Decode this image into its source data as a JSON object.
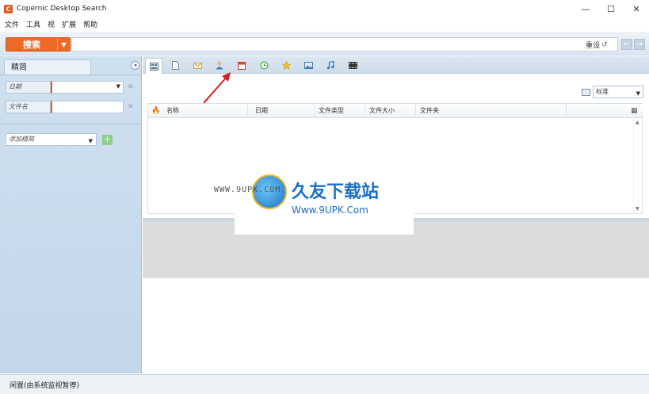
{
  "window": {
    "title": "Copernic Desktop Search",
    "minimize": "—",
    "maximize": "☐",
    "close": "✕"
  },
  "menu": [
    "文件",
    "工具",
    "视",
    "扩展",
    "帮助"
  ],
  "search": {
    "button_label": "搜索",
    "input_value": "",
    "reset_label": "重设",
    "back": "←",
    "forward": "→"
  },
  "refine": {
    "tab_label": "精简",
    "filters": [
      {
        "label": "日期",
        "value": ""
      },
      {
        "label": "文件名",
        "value": ""
      }
    ],
    "add_filter_placeholder": "添加精简"
  },
  "category_tabs": [
    {
      "icon": "all-icon"
    },
    {
      "icon": "document-icon"
    },
    {
      "icon": "email-icon"
    },
    {
      "icon": "contact-icon"
    },
    {
      "icon": "calendar-icon"
    },
    {
      "icon": "history-icon"
    },
    {
      "icon": "favorites-icon"
    },
    {
      "icon": "image-icon"
    },
    {
      "icon": "music-icon"
    },
    {
      "icon": "video-icon"
    }
  ],
  "view": {
    "selected": "标准"
  },
  "results": {
    "columns": [
      "名称",
      "日期",
      "文件类型",
      "文件大小",
      "文件夹"
    ]
  },
  "status": {
    "text": "闲置(由系统监视暂停)"
  },
  "watermark": {
    "left_text": "WWW.9UPK.COM",
    "brand": "久友下载站",
    "url": "Www.9UPK.Com"
  },
  "colors": {
    "accent": "#ec6a26",
    "panel": "#c9dcee",
    "arrow": "#d21f1f"
  }
}
